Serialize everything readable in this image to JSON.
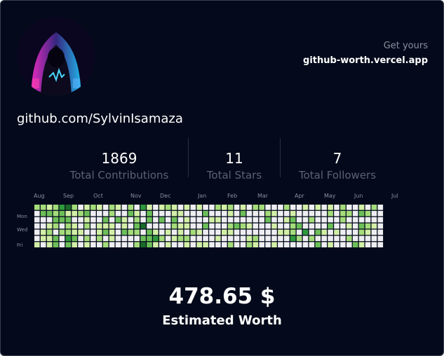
{
  "header": {
    "get_yours_label": "Get yours",
    "get_yours_link": "github-worth.vercel.app"
  },
  "profile": {
    "username": "github.com/SylvinIsamaza",
    "avatar_icon": "hooded-figure-avatar-icon"
  },
  "stats": [
    {
      "value": "1869",
      "label": "Total Contributions"
    },
    {
      "value": "11",
      "label": "Total Stars"
    },
    {
      "value": "7",
      "label": "Total Followers"
    }
  ],
  "calendar": {
    "months": [
      "Aug",
      "Sep",
      "Oct",
      "Nov",
      "Dec",
      "Jan",
      "Feb",
      "Mar",
      "Apr",
      "May",
      "Jun",
      "Jul"
    ],
    "days": [
      "Mon",
      "Wed",
      "Fri"
    ],
    "colors": [
      "#eeeef2",
      "#d3efa6",
      "#a4dc7a",
      "#6cbf58",
      "#2f9a3c",
      "#1a6a2a"
    ],
    "weeks": [
      "2000001",
      "2300110",
      "1301211",
      "2232033",
      "4330200",
      "5132243",
      "2101131",
      "0200100",
      "1312021",
      "2000000",
      "1001120",
      "0031302",
      "2201110",
      "1030000",
      "0011300",
      "2300200",
      "0123202",
      "4005035",
      "1330333",
      "0000141",
      "1030020",
      "2000101",
      "1132010",
      "0101120",
      "1011021",
      "0000200",
      "1000101",
      "0303001",
      "0010000",
      "2010010",
      "1000100",
      "2102102",
      "0003000",
      "1302000",
      "0001012",
      "2000021",
      "2000000",
      "0230000",
      "0101001",
      "0000100",
      "2010100",
      "0132240",
      "0003020",
      "1000400",
      "0020020",
      "1000303",
      "0000100",
      "1203001",
      "0000100",
      "2220000",
      "0201020",
      "0000003",
      "1303201",
      "0202100",
      "2001000",
      "0000000"
    ]
  },
  "worth": {
    "value": "478.65 $",
    "label": "Estimated Worth"
  }
}
